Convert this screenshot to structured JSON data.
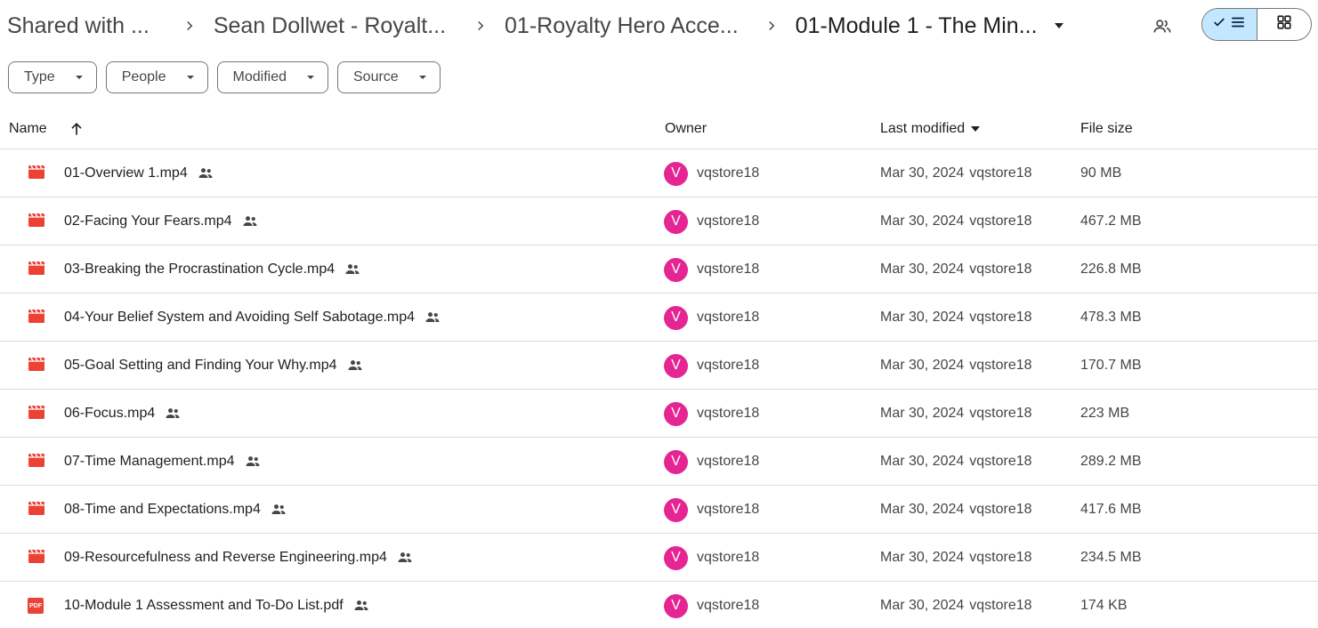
{
  "breadcrumb": {
    "items": [
      "Shared with ...",
      "Sean Dollwet - Royalt...",
      "01-Royalty Hero Acce...",
      "01-Module 1 - The Min..."
    ]
  },
  "filters": {
    "type": "Type",
    "people": "People",
    "modified": "Modified",
    "source": "Source"
  },
  "table": {
    "headers": {
      "name": "Name",
      "owner": "Owner",
      "modified": "Last modified",
      "size": "File size"
    },
    "rows": [
      {
        "name": "01-Overview 1.mp4",
        "kind": "video",
        "owner": "vqstore18",
        "avatar": "V",
        "date": "Mar 30, 2024",
        "modifier": "vqstore18",
        "size": "90 MB"
      },
      {
        "name": "02-Facing Your Fears.mp4",
        "kind": "video",
        "owner": "vqstore18",
        "avatar": "V",
        "date": "Mar 30, 2024",
        "modifier": "vqstore18",
        "size": "467.2 MB"
      },
      {
        "name": "03-Breaking the Procrastination Cycle.mp4",
        "kind": "video",
        "owner": "vqstore18",
        "avatar": "V",
        "date": "Mar 30, 2024",
        "modifier": "vqstore18",
        "size": "226.8 MB"
      },
      {
        "name": "04-Your Belief System and Avoiding Self Sabotage.mp4",
        "kind": "video",
        "owner": "vqstore18",
        "avatar": "V",
        "date": "Mar 30, 2024",
        "modifier": "vqstore18",
        "size": "478.3 MB"
      },
      {
        "name": "05-Goal Setting and Finding Your Why.mp4",
        "kind": "video",
        "owner": "vqstore18",
        "avatar": "V",
        "date": "Mar 30, 2024",
        "modifier": "vqstore18",
        "size": "170.7 MB"
      },
      {
        "name": "06-Focus.mp4",
        "kind": "video",
        "owner": "vqstore18",
        "avatar": "V",
        "date": "Mar 30, 2024",
        "modifier": "vqstore18",
        "size": "223 MB"
      },
      {
        "name": "07-Time Management.mp4",
        "kind": "video",
        "owner": "vqstore18",
        "avatar": "V",
        "date": "Mar 30, 2024",
        "modifier": "vqstore18",
        "size": "289.2 MB"
      },
      {
        "name": "08-Time and Expectations.mp4",
        "kind": "video",
        "owner": "vqstore18",
        "avatar": "V",
        "date": "Mar 30, 2024",
        "modifier": "vqstore18",
        "size": "417.6 MB"
      },
      {
        "name": "09-Resourcefulness and Reverse Engineering.mp4",
        "kind": "video",
        "owner": "vqstore18",
        "avatar": "V",
        "date": "Mar 30, 2024",
        "modifier": "vqstore18",
        "size": "234.5 MB"
      },
      {
        "name": "10-Module 1 Assessment and To-Do List.pdf",
        "kind": "pdf",
        "pdf_label": "PDF",
        "owner": "vqstore18",
        "avatar": "V",
        "date": "Mar 30, 2024",
        "modifier": "vqstore18",
        "size": "174 KB"
      }
    ]
  },
  "colors": {
    "video_icon": "#ea4335",
    "pdf_icon": "#ea4335",
    "avatar_bg": "#e52592",
    "active_view": "#c2e7ff"
  },
  "icons": {
    "view_list": "checkmark-list-icon",
    "view_grid": "grid-icon",
    "shared": "people-icon",
    "sort": "arrow-up-icon"
  }
}
